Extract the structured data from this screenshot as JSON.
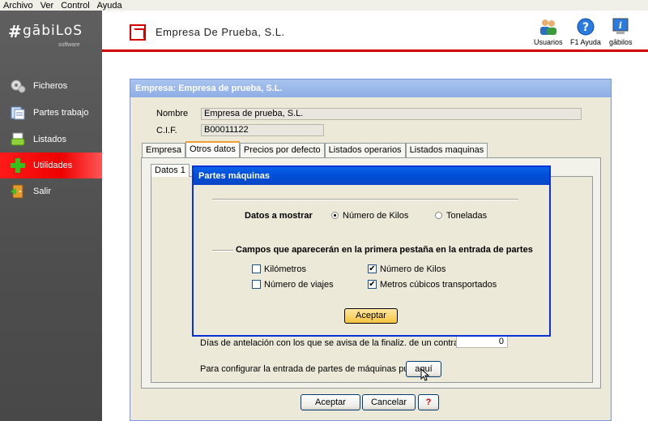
{
  "menu": [
    "Archivo",
    "Ver",
    "Control",
    "Ayuda"
  ],
  "logo": {
    "name": "gābiLoS",
    "sub": "software"
  },
  "sidebar": {
    "items": [
      {
        "label": "Ficheros"
      },
      {
        "label": "Partes trabajo"
      },
      {
        "label": "Listados"
      },
      {
        "label": "Utilidades"
      },
      {
        "label": "Salir"
      }
    ],
    "active_color": "#ee0000"
  },
  "header": {
    "title": "Empresa De Prueba, S.L.",
    "buttons": [
      {
        "label": "Usuarios",
        "icon": "users-icon"
      },
      {
        "label": "F1 Ayuda",
        "icon": "help-icon"
      },
      {
        "label": "gābilos",
        "icon": "info-icon"
      }
    ],
    "accent_color": "#d30000"
  },
  "window": {
    "title": "Empresa: Empresa de prueba, S.L.",
    "nombre_label": "Nombre",
    "nombre_value": "Empresa de prueba, S.L.",
    "cif_label": "C.I.F.",
    "cif_value": "B00011122",
    "tabs": [
      "Empresa",
      "Otros datos",
      "Precios por defecto",
      "Listados operarios",
      "Listados maquinas"
    ],
    "active_tab": "Otros datos",
    "subtabs": [
      "Datos 1"
    ],
    "dias_label": "Días de antelación con los que se avisa de la finaliz. de un contrato.......",
    "dias_value": "0",
    "config_label": "Para configurar la entrada de partes de máquinas pulse",
    "aqui_label": "aquí",
    "aceptar_label": "Aceptar",
    "cancelar_label": "Cancelar",
    "help_label": "?"
  },
  "dialog": {
    "title": "Partes máquinas",
    "datos_label": "Datos a mostrar",
    "radio_options": [
      {
        "label": "Número de Kilos",
        "selected": true
      },
      {
        "label": "Toneladas",
        "selected": false
      }
    ],
    "campos_label": "Campos que aparecerán en la primera pestaña en la entrada de partes",
    "checkboxes": [
      {
        "label": "Kilómetros",
        "checked": false
      },
      {
        "label": "Número de viajes",
        "checked": false
      },
      {
        "label": "Número de Kilos",
        "checked": true
      },
      {
        "label": "Metros cúbicos transportados",
        "checked": true
      }
    ],
    "check_mark": "✔",
    "ok_label": "Aceptar"
  }
}
